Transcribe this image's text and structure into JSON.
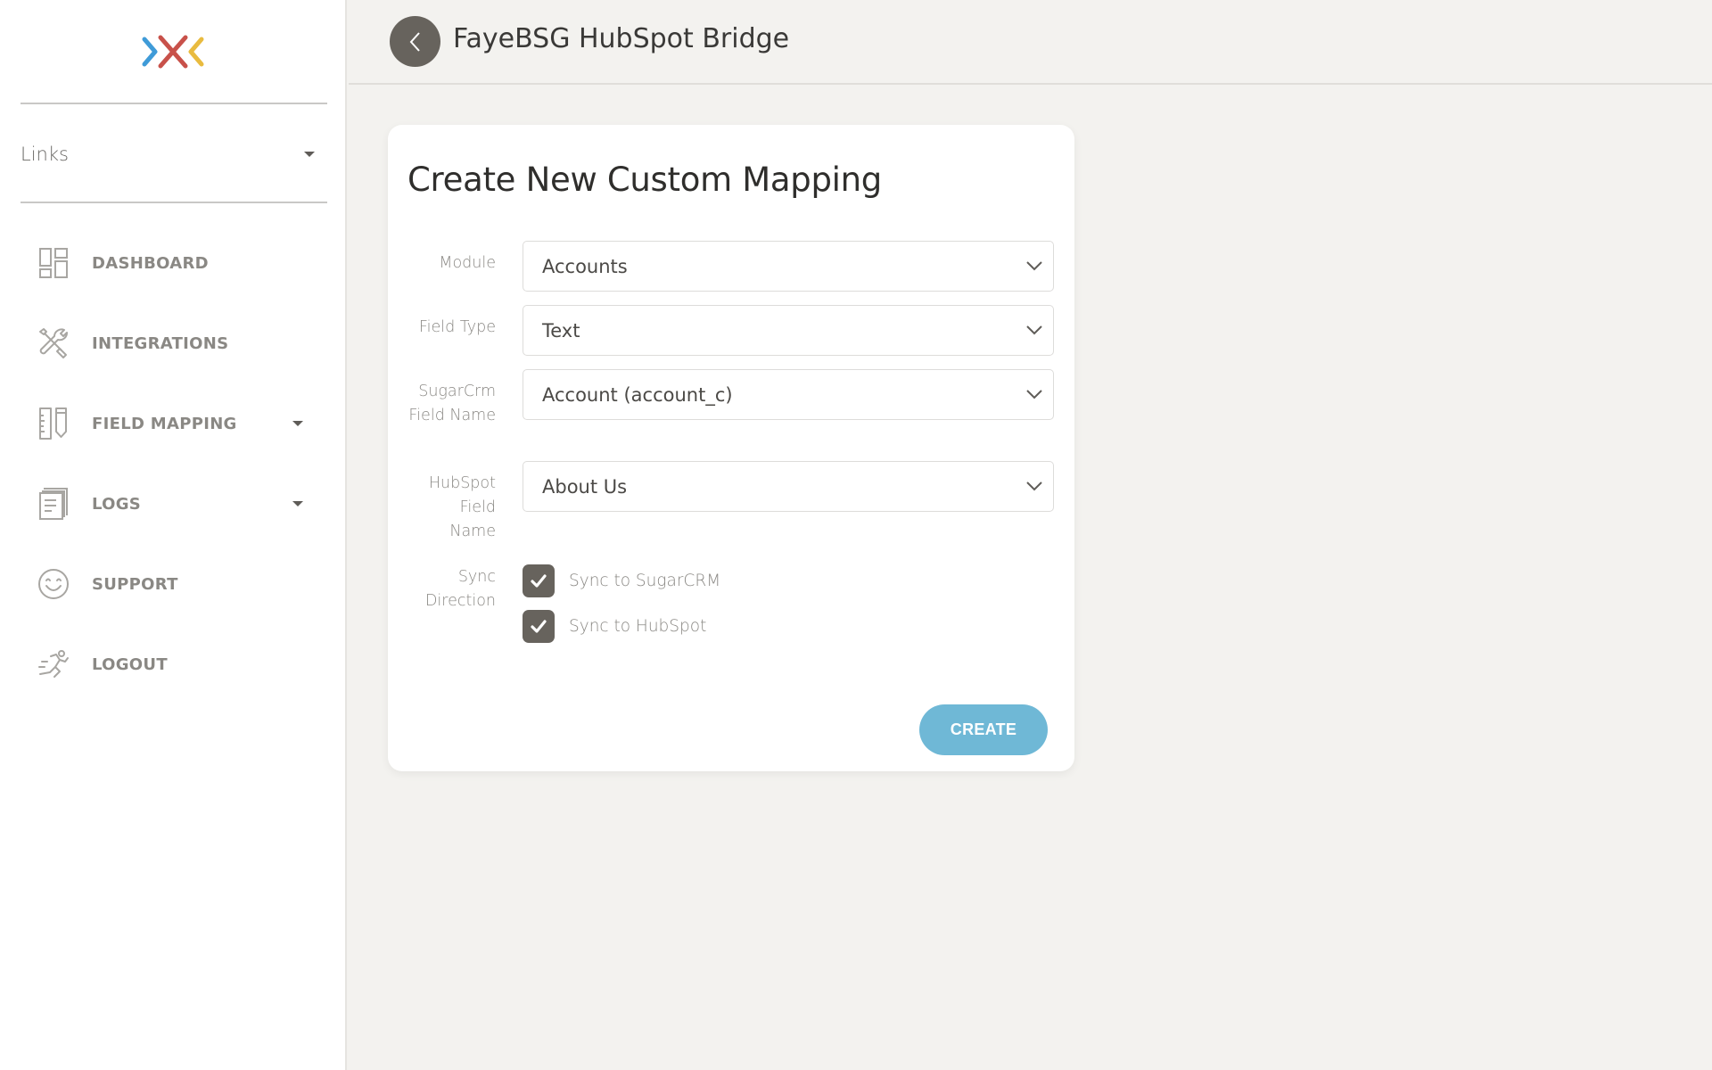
{
  "sidebar": {
    "logo_colors": {
      "left": "#3f9bd8",
      "center": "#c8514a",
      "right": "#e9bb3f"
    },
    "links_label": "Links",
    "items": [
      {
        "label": "DASHBOARD",
        "icon": "dashboard-icon",
        "has_caret": false
      },
      {
        "label": "INTEGRATIONS",
        "icon": "tools-icon",
        "has_caret": false
      },
      {
        "label": "FIELD MAPPING",
        "icon": "ruler-pencil-icon",
        "has_caret": true
      },
      {
        "label": "LOGS",
        "icon": "documents-icon",
        "has_caret": true
      },
      {
        "label": "SUPPORT",
        "icon": "smiley-icon",
        "has_caret": false
      },
      {
        "label": "LOGOUT",
        "icon": "running-person-icon",
        "has_caret": false
      }
    ]
  },
  "header": {
    "title": "FayeBSG HubSpot Bridge",
    "back_icon": "chevron-left-icon"
  },
  "form": {
    "title": "Create New Custom Mapping",
    "fields": [
      {
        "label": "Module",
        "value": "Accounts"
      },
      {
        "label": "Field Type",
        "value": "Text"
      },
      {
        "label": "SugarCrm Field Name",
        "value": "Account (account_c)"
      },
      {
        "label": "HubSpot Field Name",
        "value": "About Us"
      }
    ],
    "sync_direction": {
      "label": "Sync Direction",
      "options": [
        {
          "label": "Sync to SugarCRM",
          "checked": true
        },
        {
          "label": "Sync to HubSpot",
          "checked": true
        }
      ]
    },
    "create_label": "CREATE"
  },
  "colors": {
    "accent_button": "#6fb8d6",
    "dark_control": "#67635d",
    "background": "#f3f2ef"
  }
}
